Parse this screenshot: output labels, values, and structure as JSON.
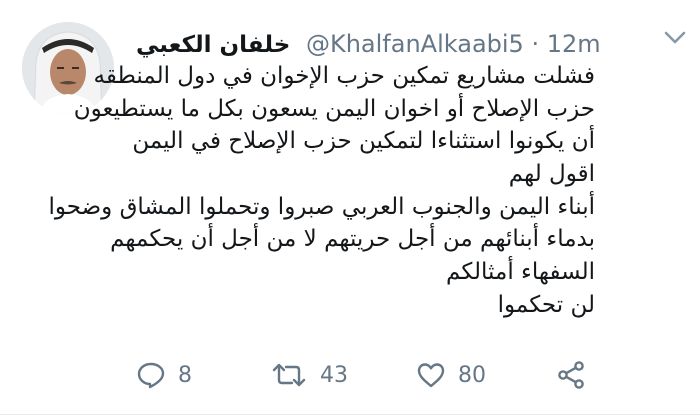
{
  "tweet": {
    "author_name": "خلفان الكعبي",
    "handle": "@KhalfanAlkaabi5",
    "separator": "·",
    "time": "12m",
    "lines": [
      "فشلت مشاريع تمكين حزب الإخوان في دول المنطقه",
      "حزب الإصلاح أو اخوان اليمن يسعون بكل ما يستطيعون",
      "أن يكونوا استثناءا لتمكين حزب الإصلاح في اليمن",
      "اقول لهم",
      "أبناء اليمن والجنوب العربي صبروا وتحملوا المشاق وضحوا",
      "بدماء أبنائهم من أجل حريتهم لا من أجل أن يحكمهم",
      "السفهاء أمثالكم",
      "لن تحكموا"
    ],
    "actions": {
      "reply_count": "8",
      "retweet_count": "43",
      "like_count": "80"
    }
  },
  "icons": {
    "menu": "chevron-down-icon",
    "reply": "reply-icon",
    "retweet": "retweet-icon",
    "like": "heart-icon",
    "share": "share-icon"
  },
  "colors": {
    "text": "#14171a",
    "secondary": "#657786",
    "icon": "#657786",
    "divider": "#e6ecf0"
  }
}
